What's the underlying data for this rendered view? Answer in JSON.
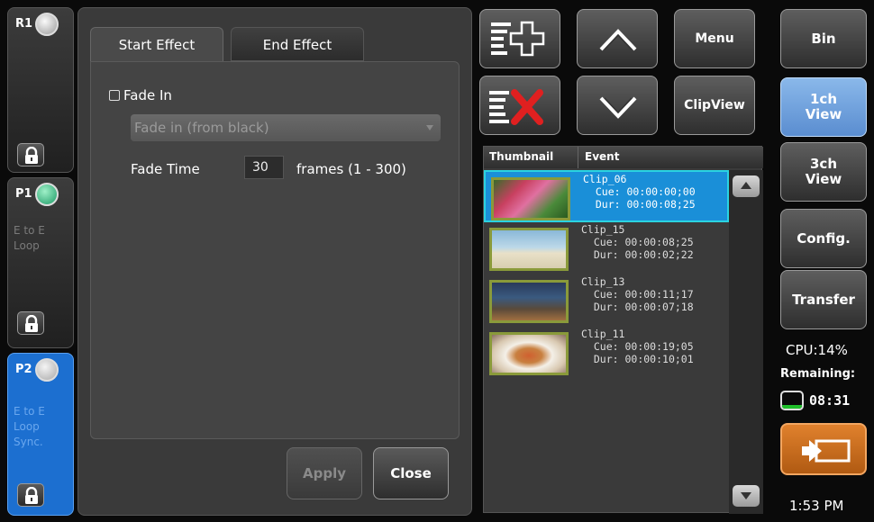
{
  "channels": {
    "r1": {
      "name": "R1"
    },
    "p1": {
      "name": "P1",
      "mode_line1": "E to E",
      "mode_line2": "Loop"
    },
    "p2": {
      "name": "P2",
      "mode_line1": "E to E",
      "mode_line2": "Loop",
      "mode_line3": "Sync."
    }
  },
  "dialog": {
    "tabs": {
      "start": "Start Effect",
      "end": "End Effect"
    },
    "fade_in_label": "Fade In",
    "fade_in_checked": false,
    "effect_select_value": "Fade in (from black)",
    "fade_time_label": "Fade Time",
    "fade_time_value": "30",
    "fade_time_units": "frames (1 - 300)",
    "apply_label": "Apply",
    "close_label": "Close"
  },
  "toolbar": {
    "add_icon": "add-list-icon",
    "delete_icon": "delete-list-icon",
    "up_icon": "chevron-up-icon",
    "down_icon": "chevron-down-icon",
    "menu_label": "Menu",
    "clip_view_label1": "Clip",
    "clip_view_label2": "View"
  },
  "clip_list": {
    "headers": {
      "thumbnail": "Thumbnail",
      "event": "Event"
    },
    "rows": [
      {
        "name": "Clip_06",
        "cue": "Cue: 00:00:00;00",
        "dur": "Dur: 00:00:08;25",
        "selected": true
      },
      {
        "name": "Clip_15",
        "cue": "Cue: 00:00:08;25",
        "dur": "Dur: 00:00:02;22",
        "selected": false
      },
      {
        "name": "Clip_13",
        "cue": "Cue: 00:00:11;17",
        "dur": "Dur: 00:00:07;18",
        "selected": false
      },
      {
        "name": "Clip_11",
        "cue": "Cue: 00:00:19;05",
        "dur": "Dur: 00:00:10;01",
        "selected": false
      }
    ]
  },
  "sidebar": {
    "bin": "Bin",
    "view1_line1": "1ch",
    "view1_line2": "View",
    "view3_line1": "3ch",
    "view3_line2": "View",
    "config": "Config.",
    "transfer": "Transfer",
    "cpu": "CPU:14%",
    "remaining_label": "Remaining:",
    "remaining_value": "08:31",
    "clock": "1:53 PM"
  },
  "colors": {
    "accent_blue": "#1c6fd0",
    "selection": "#1a8fd8",
    "delete_red": "#e02020",
    "back_orange": "#d47520"
  }
}
